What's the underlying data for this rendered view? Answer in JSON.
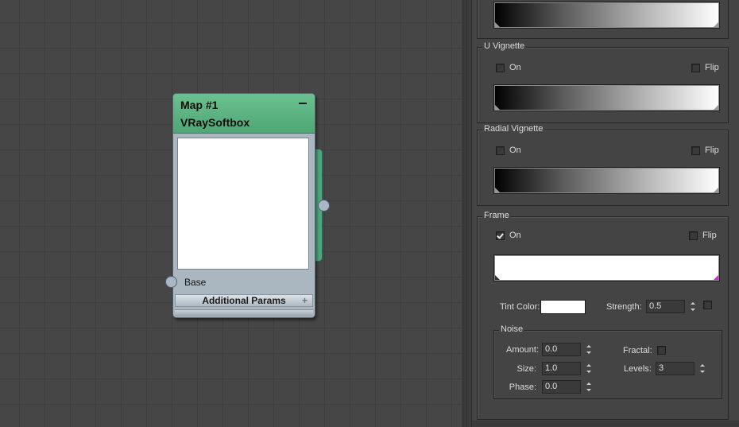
{
  "node": {
    "title": "Map #1",
    "subtitle": "VRaySoftbox",
    "input_label": "Base",
    "section_label": "Additional Params",
    "header_color": "#5db584",
    "body_color": "#aab6c0"
  },
  "panel": {
    "u_vignette": {
      "title": "U Vignette",
      "on_label": "On",
      "on_checked": false,
      "flip_label": "Flip",
      "flip_checked": false
    },
    "radial_vignette": {
      "title": "Radial Vignette",
      "on_label": "On",
      "on_checked": false,
      "flip_label": "Flip",
      "flip_checked": false
    },
    "frame": {
      "title": "Frame",
      "on_label": "On",
      "on_checked": true,
      "flip_label": "Flip",
      "flip_checked": false,
      "tint_color_label": "Tint Color:",
      "tint_color": "#ffffff",
      "strength_label": "Strength:",
      "strength_value": "0.5",
      "strength_map_checked": false,
      "noise": {
        "title": "Noise",
        "amount_label": "Amount:",
        "amount_value": "0.0",
        "size_label": "Size:",
        "size_value": "1.0",
        "phase_label": "Phase:",
        "phase_value": "0.0",
        "fractal_label": "Fractal:",
        "fractal_checked": false,
        "levels_label": "Levels:",
        "levels_value": "3"
      }
    }
  }
}
